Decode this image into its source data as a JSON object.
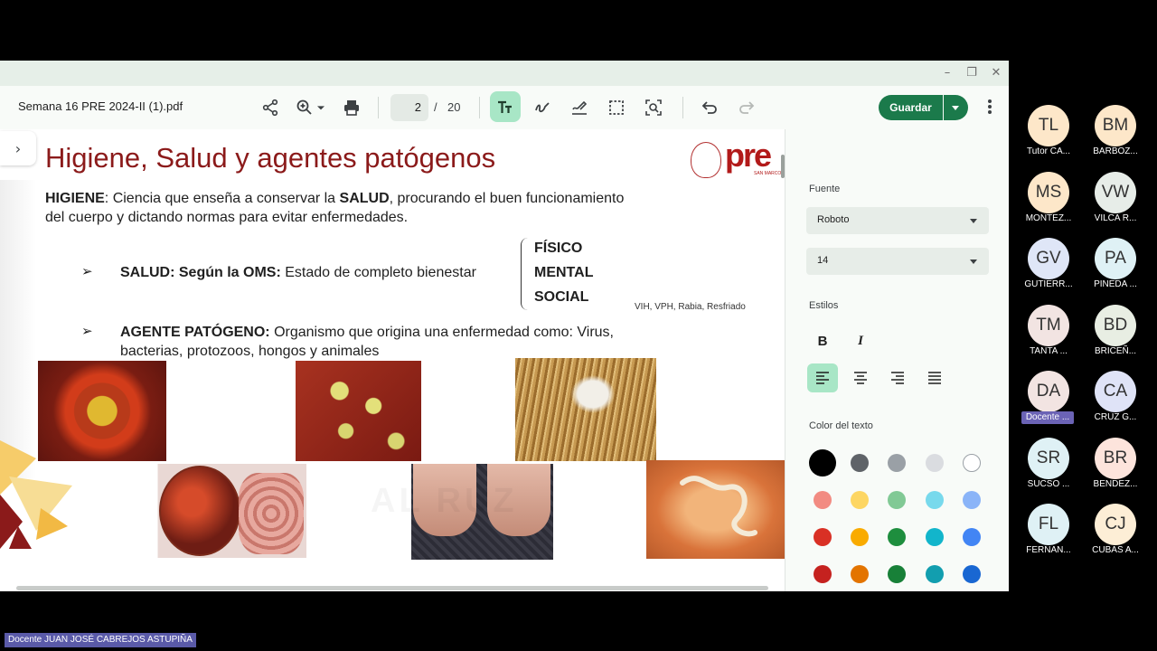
{
  "viewer": {
    "filename": "Semana 16 PRE 2024-II (1).pdf",
    "page_current": "2",
    "page_separator": "/",
    "page_total": "20",
    "save_label": "Guardar"
  },
  "slide": {
    "title": "Higiene, Salud y agentes patógenos",
    "logo_text": "pre",
    "logo_sub": "SAN MARCOS",
    "higiene_term": "HIGIENE",
    "higiene_def_a": ": Ciencia que enseña a conservar la ",
    "higiene_salud": "SALUD",
    "higiene_def_b": ", procurando el buen funcionamiento",
    "higiene_line2": "del cuerpo y dictando normas para evitar enfermedades.",
    "bullet_glyph": "➢",
    "salud_label": "SALUD: Según la OMS:",
    "salud_def": " Estado de completo bienestar",
    "wellbeing": [
      "FÍSICO",
      "MENTAL",
      "SOCIAL"
    ],
    "note": "VIH, VPH, Rabia, Resfriado",
    "agente_label": "AGENTE PATÓGENO:",
    "agente_def": " Organismo que origina una enfermedad como: Virus,",
    "agente_line2": "bacterias, protozoos, hongos y animales",
    "watermark": "AL    RUZ"
  },
  "panel": {
    "font_label": "Fuente",
    "font_value": "Roboto",
    "size_value": "14",
    "styles_label": "Estilos",
    "bold_glyph": "B",
    "italic_glyph": "I",
    "color_label": "Color del texto",
    "swatches": [
      "#000000",
      "#5f6368",
      "#9aa0a6",
      "#dadce0",
      "#ffffff",
      "#f28b82",
      "#fdd663",
      "#81c995",
      "#78d9ec",
      "#8ab4f8",
      "#d93025",
      "#f9ab00",
      "#1e8e3e",
      "#12b5cb",
      "#4285f4",
      "#c5221f",
      "#e37400",
      "#188038",
      "#129eaf",
      "#1967d2"
    ]
  },
  "participants": [
    {
      "initials": "TL",
      "name": "Tutor CA...",
      "color": "#fde7c9"
    },
    {
      "initials": "BM",
      "name": "BARBOZ...",
      "color": "#fde7c9"
    },
    {
      "initials": "MS",
      "name": "MONTEZ...",
      "color": "#fde7c9"
    },
    {
      "initials": "VW",
      "name": "VILCA R...",
      "color": "#e7ede8"
    },
    {
      "initials": "GV",
      "name": "GUTIERR...",
      "color": "#dfe6f7"
    },
    {
      "initials": "PA",
      "name": "PINEDA ...",
      "color": "#dff1f5"
    },
    {
      "initials": "TM",
      "name": "TANTA ...",
      "color": "#f2e4e2"
    },
    {
      "initials": "BD",
      "name": "BRICEÑ...",
      "color": "#e8eee3"
    },
    {
      "initials": "DA",
      "name": "Docente ...",
      "color": "#f2e4e2"
    },
    {
      "initials": "CA",
      "name": "CRUZ G...",
      "color": "#dfe3f7"
    },
    {
      "initials": "SR",
      "name": "SUCSO ...",
      "color": "#dff1f5"
    },
    {
      "initials": "BR",
      "name": "BENDEZ...",
      "color": "#fde4dc"
    },
    {
      "initials": "FL",
      "name": "FERNAN...",
      "color": "#dff1f5"
    },
    {
      "initials": "CJ",
      "name": "CUBAS A...",
      "color": "#fdeed6"
    }
  ],
  "speaker": "Docente JUAN JOSÉ CABREJOS ASTUPIÑA"
}
